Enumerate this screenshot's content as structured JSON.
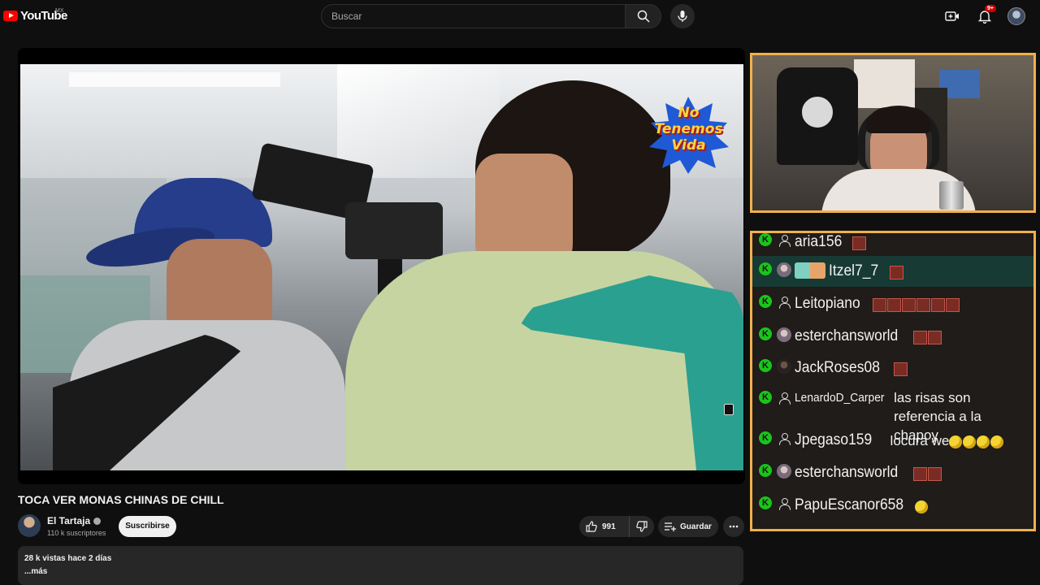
{
  "header": {
    "logo_text": "YouTube",
    "country_code": "MX",
    "search_placeholder": "Buscar",
    "notifications_badge": "9+"
  },
  "video": {
    "overlay_stamp": "No Tenemos Vida",
    "title": "TOCA VER MONAS CHINAS DE CHILL"
  },
  "channel": {
    "name": "El Tartaja",
    "subscribers": "110 k suscriptores",
    "subscribe_label": "Suscribirse"
  },
  "actions": {
    "likes": "991",
    "save_label": "Guardar"
  },
  "description": {
    "meta": "28 k vistas  hace 2 días",
    "more": "...más"
  },
  "chat": {
    "messages": [
      {
        "user": "aria156",
        "text": "",
        "emotes": 1,
        "highlight": false,
        "avatar": "ghost"
      },
      {
        "user": "Itzel7_7",
        "text": "",
        "emotes": 1,
        "highlight": true,
        "avatar": "image"
      },
      {
        "user": "Leitopiano",
        "text": "",
        "emotes": 6,
        "highlight": false,
        "avatar": "ghost"
      },
      {
        "user": "esterchansworld",
        "text": "",
        "emotes": 2,
        "highlight": false,
        "avatar": "image"
      },
      {
        "user": "JackRoses08",
        "text": "",
        "emotes": 1,
        "highlight": false,
        "avatar": "image"
      },
      {
        "user": "LenardoD_Carper",
        "text": "las risas son referencia a la chapoy",
        "emotes": 0,
        "highlight": false,
        "avatar": "ghost"
      },
      {
        "user": "Jpegaso159",
        "text": "locura we",
        "emotes": 0,
        "laughs": 4,
        "highlight": false,
        "avatar": "ghost"
      },
      {
        "user": "esterchansworld",
        "text": "",
        "emotes": 2,
        "highlight": false,
        "avatar": "image"
      },
      {
        "user": "PapuEscanor658",
        "text": "",
        "emotes": 0,
        "laughs": 1,
        "highlight": false,
        "avatar": "ghost"
      }
    ]
  },
  "colors": {
    "brand_red": "#ff0000",
    "frame_orange": "#f0b04b",
    "mod_green": "#1ac51a",
    "highlight_row": "#173a35"
  }
}
